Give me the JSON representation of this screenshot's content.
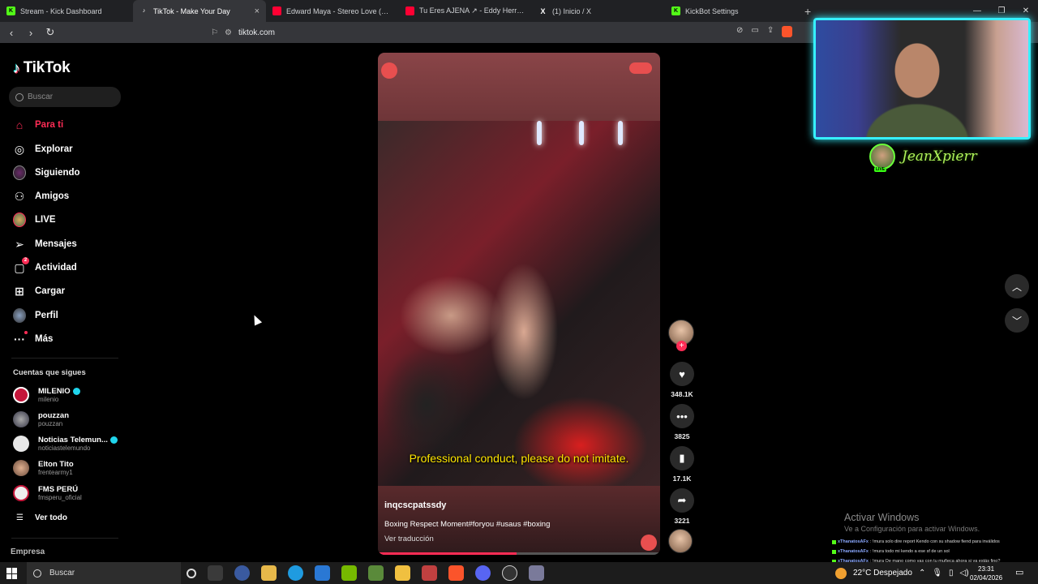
{
  "browser": {
    "tabs": [
      {
        "title": "Stream - Kick Dashboard",
        "favicon_color": "#53fc18"
      },
      {
        "title": "TikTok - Make Your Day",
        "favicon_color": "#ffffff"
      },
      {
        "title": "Edward Maya - Stereo Love (Official",
        "favicon_color": "#ff0033"
      },
      {
        "title": "Tu Eres AJENA ↗ - Eddy Herrera [V",
        "favicon_color": "#ff0033"
      },
      {
        "title": "(1) Inicio / X",
        "favicon_color": "#ffffff"
      },
      {
        "title": "KickBot Settings",
        "favicon_color": "#53fc18"
      }
    ],
    "url": "tiktok.com"
  },
  "sidebar": {
    "logo": "TikTok",
    "search_placeholder": "Buscar",
    "nav": [
      {
        "label": "Para ti",
        "icon": "home-icon",
        "active": true
      },
      {
        "label": "Explorar",
        "icon": "compass-icon"
      },
      {
        "label": "Siguiendo",
        "icon": "following-icon"
      },
      {
        "label": "Amigos",
        "icon": "friends-icon"
      },
      {
        "label": "LIVE",
        "icon": "live-icon"
      },
      {
        "label": "Mensajes",
        "icon": "messages-icon"
      },
      {
        "label": "Actividad",
        "icon": "activity-icon",
        "badge": "2"
      },
      {
        "label": "Cargar",
        "icon": "upload-icon"
      },
      {
        "label": "Perfil",
        "icon": "profile-icon"
      },
      {
        "label": "Más",
        "icon": "more-icon"
      }
    ],
    "following_title": "Cuentas que sigues",
    "accounts": [
      {
        "name": "MILENIO",
        "handle": "milenio",
        "verified": true,
        "color": "#c4163a"
      },
      {
        "name": "pouzzan",
        "handle": "pouzzan",
        "verified": false,
        "color": "#555566"
      },
      {
        "name": "Noticias Telemun...",
        "handle": "noticiastelemundo",
        "verified": true,
        "color": "#d9d9d9"
      },
      {
        "name": "Elton Tito",
        "handle": "frentearmy1",
        "verified": false,
        "color": "#c99a80"
      },
      {
        "name": "FMS PERÚ",
        "handle": "fmsperu_oficial",
        "verified": false,
        "color": "#e6e6e6"
      }
    ],
    "see_all": "Ver todo",
    "company": "Empresa"
  },
  "video": {
    "subtitle": "Professional conduct, please do not imitate.",
    "author": "inqcscpatssdy",
    "caption": "Boxing Respect Moment#foryou #usaus #boxing",
    "translate": "Ver traducción",
    "progress": 0.49
  },
  "actions": {
    "likes": "348.1K",
    "comments": "3825",
    "saves": "17.1K",
    "shares": "3221"
  },
  "stream_overlay": {
    "streamer": "JeanXpierr",
    "live_label": "LIVE",
    "border_color": "#36f0ff"
  },
  "windows": {
    "activate_title": "Activar Windows",
    "activate_sub": "Ve a Configuración para activar Windows.",
    "chat": [
      {
        "user": "xThanatosAFx",
        "msg": ": !mura solo dire report Kendo con su shadow fiend para inválidos"
      },
      {
        "user": "xThanatosAFx",
        "msg": ": !mura todo mi kendo a ese sf de un sol"
      },
      {
        "user": "xThanatosAFx",
        "msg": ": !mura Oe mano como vas con tu muñeca ahora si ya estás fino?"
      }
    ]
  },
  "taskbar": {
    "search_placeholder": "Buscar",
    "weather": "22°C  Despejado",
    "time": "23:31",
    "date": "02/04/2026"
  }
}
